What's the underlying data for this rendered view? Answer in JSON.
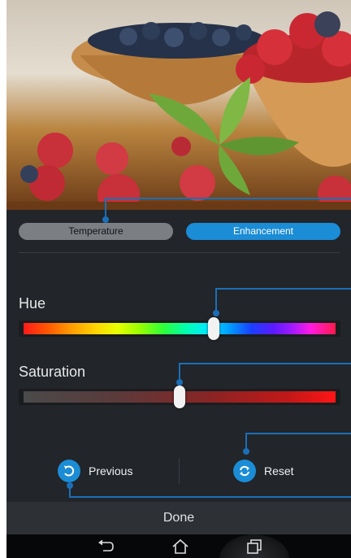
{
  "tabs": [
    {
      "label": "Temperature",
      "active": false
    },
    {
      "label": "Enhancement",
      "active": true
    }
  ],
  "sliders": {
    "hue": {
      "label": "Hue",
      "value_fraction": 0.61
    },
    "saturation": {
      "label": "Saturation",
      "value_fraction": 0.5
    }
  },
  "actions": {
    "previous_label": "Previous",
    "reset_label": "Reset"
  },
  "done_label": "Done",
  "navbar": {
    "icons": [
      "back-icon",
      "home-icon",
      "recent-apps-icon"
    ]
  },
  "colors": {
    "accent": "#1b8cd6",
    "panel_bg": "#222529",
    "done_bar_bg": "#2d3136"
  }
}
